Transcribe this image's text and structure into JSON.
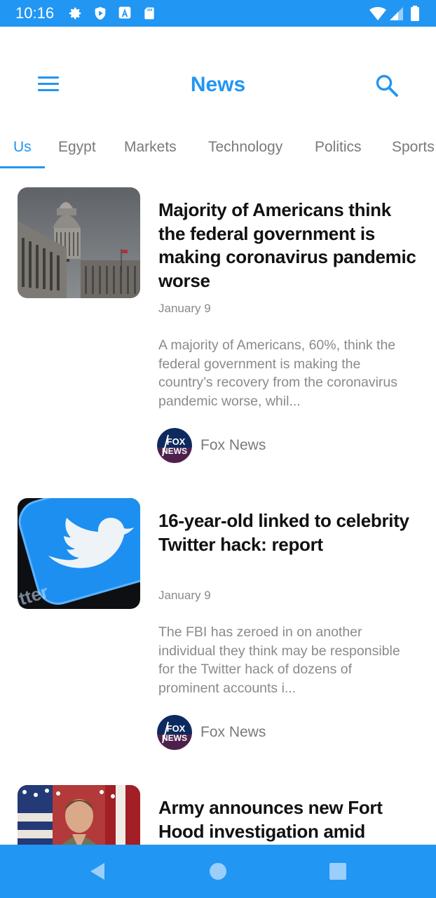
{
  "status_bar": {
    "time": "10:16",
    "left_icons": [
      "settings-icon",
      "shield-icon",
      "app-a-icon",
      "sd-card-icon"
    ],
    "right_icons": [
      "wifi-icon",
      "signal-icon",
      "battery-icon"
    ]
  },
  "app_bar": {
    "title": "News",
    "menu_icon": "hamburger-menu-icon",
    "search_icon": "search-icon",
    "accent_color": "#2196F3"
  },
  "tabs": [
    {
      "label": "Us",
      "active": true
    },
    {
      "label": "Egypt",
      "active": false
    },
    {
      "label": "Markets",
      "active": false
    },
    {
      "label": "Technology",
      "active": false
    },
    {
      "label": "Politics",
      "active": false
    },
    {
      "label": "Sports",
      "active": false
    }
  ],
  "articles": [
    {
      "title": "Majority of Americans think the federal government is making coronavirus pandemic worse",
      "date": "January 9",
      "description": "A majority of Americans, 60%, think the federal government is making the country’s recovery from the coronavirus pandemic worse, whil...",
      "source": "Fox News",
      "source_logo_text": [
        "FOX",
        "NEWS"
      ]
    },
    {
      "title": "16-year-old linked to celebrity Twitter hack: report",
      "date": "January 9",
      "description": "The FBI has zeroed in on another individual they think may be responsible for the Twitter hack of dozens of prominent accounts i...",
      "source": "Fox News",
      "source_logo_text": [
        "FOX",
        "NEWS"
      ]
    },
    {
      "title": "Army announces new Fort Hood investigation amid"
    }
  ],
  "nav_bar": {
    "icons": [
      "back-icon",
      "home-icon",
      "recents-icon"
    ]
  }
}
